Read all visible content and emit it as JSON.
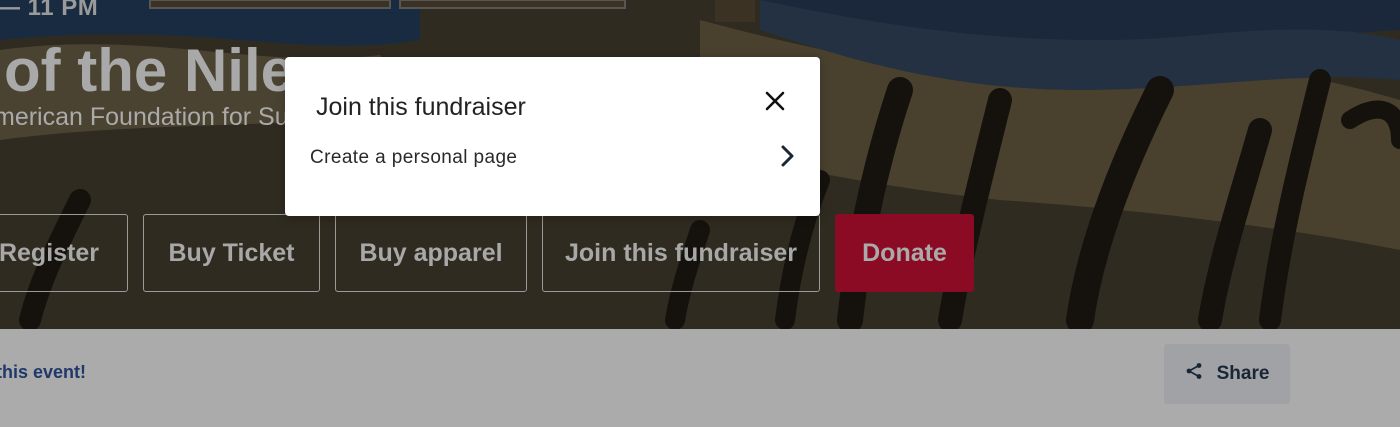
{
  "hero": {
    "time": "— 11 PM",
    "title": "of the Nile",
    "subtitle": "merican Foundation for Su"
  },
  "actions": {
    "register": "Register",
    "buy_ticket": "Buy Ticket",
    "buy_apparel": "Buy apparel",
    "join_fundraiser": "Join this fundraiser",
    "donate": "Donate"
  },
  "footer": {
    "event_text": "this event!",
    "share_label": "Share"
  },
  "modal": {
    "title": "Join this fundraiser",
    "option_label": "Create a personal page"
  },
  "colors": {
    "donate": "#8b0a24",
    "footer_link": "#21386a",
    "overlay_bg": "#ababab"
  },
  "icons": {
    "close": "close-icon",
    "chevron": "chevron-right-icon",
    "share": "share-icon"
  }
}
